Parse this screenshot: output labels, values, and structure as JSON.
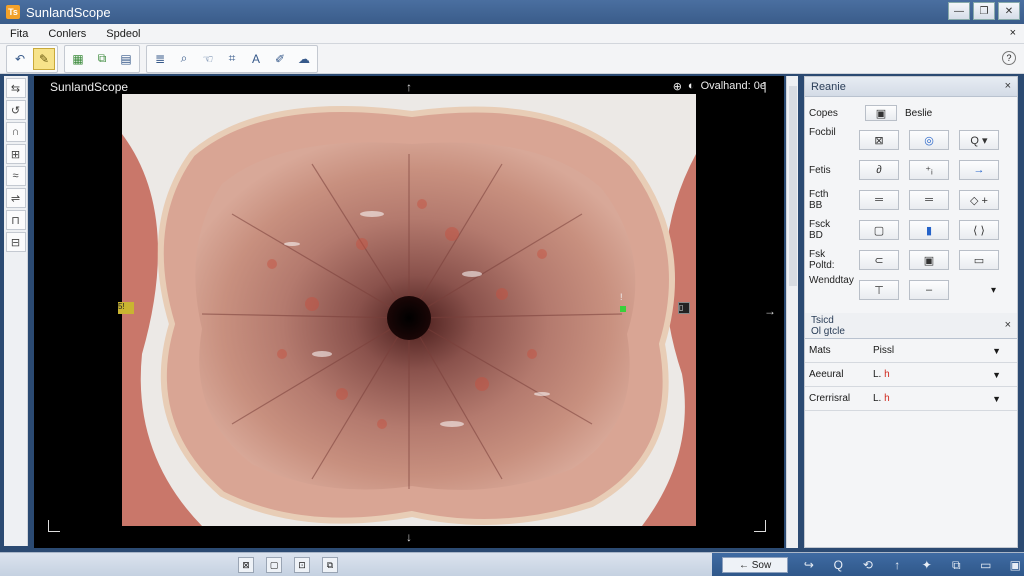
{
  "window": {
    "title": "SunlandScope",
    "logo": "Ts",
    "controls": [
      "minimize-icon",
      "restore-icon",
      "close-icon"
    ]
  },
  "menu": {
    "items": [
      "Fita",
      "Conlers",
      "Spdeol"
    ],
    "close": "×"
  },
  "toolbar": {
    "groups": [
      [
        "undo-icon",
        "pencil-icon"
      ],
      [
        "grid-icon",
        "folder-icon",
        "save-icon"
      ],
      [
        "layers-icon",
        "zoom-icon",
        "hand-icon",
        "crop-icon",
        "text-icon",
        "brush-icon",
        "cloud-icon"
      ]
    ],
    "help": "?"
  },
  "left_tools": [
    "⇆",
    "↺",
    "∩",
    "⊞",
    "≈",
    "⇌",
    "⊓",
    "⊟"
  ],
  "viewport": {
    "label": "SunlandScope",
    "overlay": [
      "⊕",
      "◐",
      "Ovalhand: 0e"
    ],
    "marker_left": "5!",
    "marker_right": "▯",
    "edge_marker": "!"
  },
  "panel": {
    "title": "Reanie",
    "close": "×",
    "rows": [
      {
        "label": "Copes",
        "cells": [
          "▣",
          "Beslie"
        ]
      },
      {
        "label": "Focbil",
        "cells": [
          "⊠",
          "◎",
          "Q ▾"
        ]
      },
      {
        "label": "Fetis",
        "cells": [
          "∂",
          "⁺ᵢ",
          "→"
        ]
      },
      {
        "label": "Fcth\nBB",
        "cells": [
          "═",
          "═",
          "◇ +"
        ]
      },
      {
        "label": "Fsck\nBD",
        "cells": [
          "▢",
          "▮",
          "⟨ ⟩"
        ]
      },
      {
        "label": "Fsk\nPoltd:",
        "cells": [
          "⊂",
          "▣",
          "▭"
        ]
      },
      {
        "label": "Wenddtay",
        "cells": [
          "⊤",
          "–",
          "▾"
        ]
      }
    ]
  },
  "section2": {
    "title": "Tsicd\nOl gtcle",
    "close": "×",
    "dropdowns": [
      {
        "label": "Mats",
        "value": "Pissl",
        "red": ""
      },
      {
        "label": "Aeeural",
        "value": "L. ",
        "red": "h"
      },
      {
        "label": "Crerrisral",
        "value": "L. ",
        "red": "h"
      }
    ]
  },
  "status": {
    "icons": [
      "⊠",
      "▢",
      "⊡",
      "⧉"
    ],
    "save_label": "← Sow",
    "right_icons": [
      "↪",
      "Q",
      "⟲",
      "↑",
      "✦",
      "⧉",
      "▭",
      "▣"
    ]
  }
}
